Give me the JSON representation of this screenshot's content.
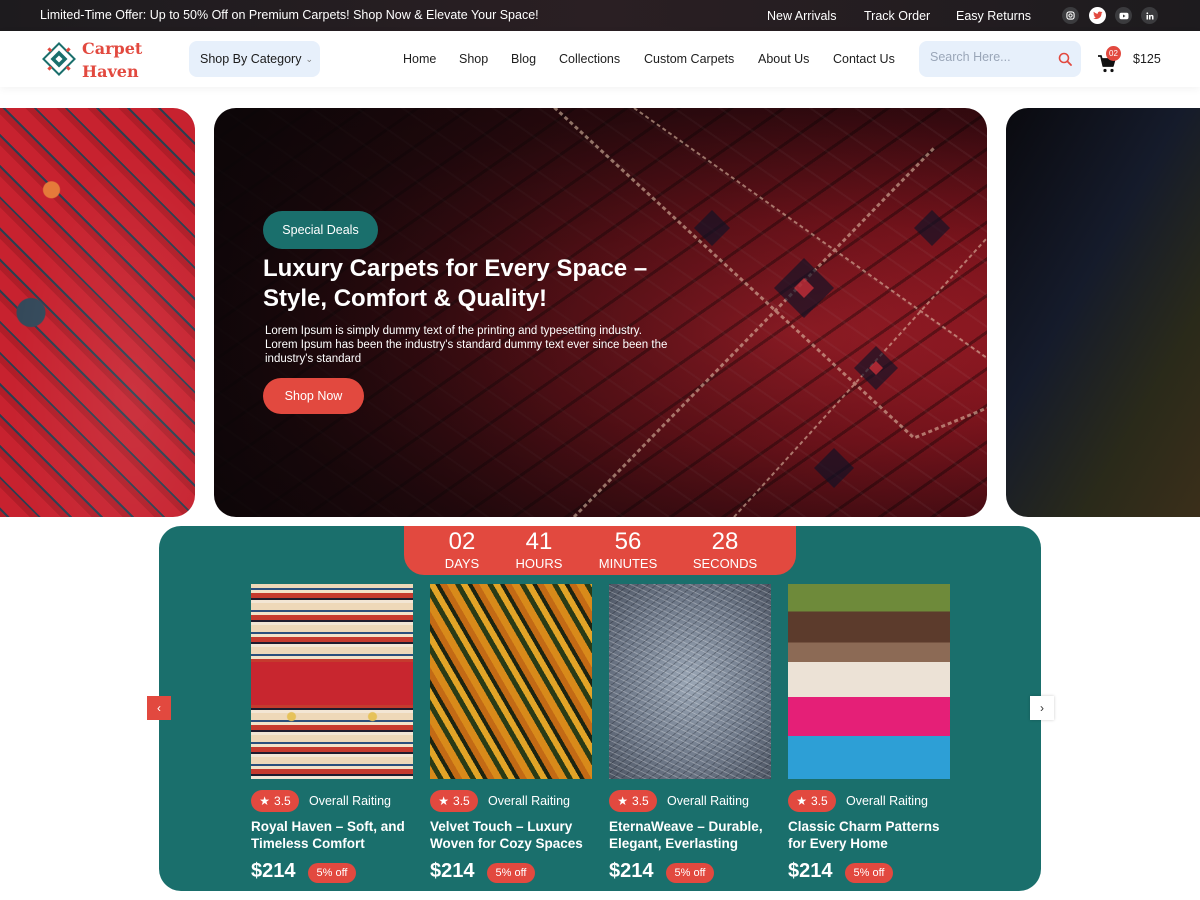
{
  "topbar": {
    "offer": "Limited-Time Offer: Up to 50% Off on Premium Carpets! Shop Now & Elevate Your Space!",
    "links": [
      "New Arrivals",
      "Track Order",
      "Easy Returns"
    ],
    "social": [
      "instagram-icon",
      "twitter-icon",
      "youtube-icon",
      "linkedin-icon"
    ]
  },
  "header": {
    "logo_line1": "Carpet",
    "logo_line2": "Haven",
    "category_button": "Shop By Category",
    "nav": [
      "Home",
      "Shop",
      "Blog",
      "Collections",
      "Custom Carpets",
      "About Us",
      "Contact Us"
    ],
    "search_placeholder": "Search Here...",
    "cart_count": "02",
    "cart_total": "$125"
  },
  "hero": {
    "badge": "Special Deals",
    "title": "Luxury Carpets for Every Space – Style, Comfort & Quality!",
    "text": "Lorem Ipsum is simply dummy text of the printing and typesetting industry. Lorem Ipsum has been the industry's standard dummy text ever since  been the industry's standard",
    "button": "Shop Now"
  },
  "countdown": [
    {
      "value": "02",
      "label": "DAYS"
    },
    {
      "value": "41",
      "label": "HOURS"
    },
    {
      "value": "56",
      "label": "MINUTES"
    },
    {
      "value": "28",
      "label": "SECONDS"
    }
  ],
  "products": [
    {
      "rating": "3.5",
      "rating_label": "Overall Raiting",
      "title": "Royal Haven – Soft, and Timeless Comfort",
      "price": "$214",
      "discount": "5% off"
    },
    {
      "rating": "3.5",
      "rating_label": "Overall Raiting",
      "title": "Velvet Touch – Luxury Woven for Cozy Spaces",
      "price": "$214",
      "discount": "5% off"
    },
    {
      "rating": "3.5",
      "rating_label": "Overall Raiting",
      "title": "EternaWeave – Durable, Elegant, Everlasting",
      "price": "$214",
      "discount": "5% off"
    },
    {
      "rating": "3.5",
      "rating_label": "Overall Raiting",
      "title": "Classic Charm Patterns for Every Home",
      "price": "$214",
      "discount": "5% off"
    }
  ],
  "colors": {
    "accent": "#e2493f",
    "teal": "#1a6f6c",
    "search_bg": "#e7f0fb"
  }
}
